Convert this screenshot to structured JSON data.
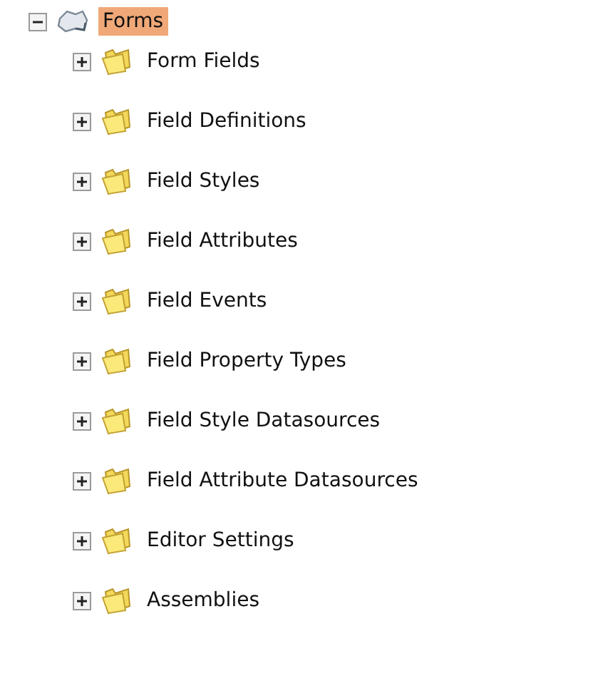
{
  "tree": [
    {
      "label": "Forms",
      "expanded": true,
      "selected": true,
      "kind": "root",
      "children": [
        {
          "label": "Form Fields",
          "expanded": false,
          "selected": false,
          "kind": "folder"
        },
        {
          "label": "Field Definitions",
          "expanded": false,
          "selected": false,
          "kind": "folder"
        },
        {
          "label": "Field Styles",
          "expanded": false,
          "selected": false,
          "kind": "folder"
        },
        {
          "label": "Field Attributes",
          "expanded": false,
          "selected": false,
          "kind": "folder"
        },
        {
          "label": "Field Events",
          "expanded": false,
          "selected": false,
          "kind": "folder"
        },
        {
          "label": "Field Property Types",
          "expanded": false,
          "selected": false,
          "kind": "folder"
        },
        {
          "label": "Field Style Datasources",
          "expanded": false,
          "selected": false,
          "kind": "folder"
        },
        {
          "label": "Field Attribute Datasources",
          "expanded": false,
          "selected": false,
          "kind": "folder"
        },
        {
          "label": "Editor Settings",
          "expanded": false,
          "selected": false,
          "kind": "folder"
        },
        {
          "label": "Assemblies",
          "expanded": false,
          "selected": false,
          "kind": "folder"
        }
      ]
    }
  ]
}
